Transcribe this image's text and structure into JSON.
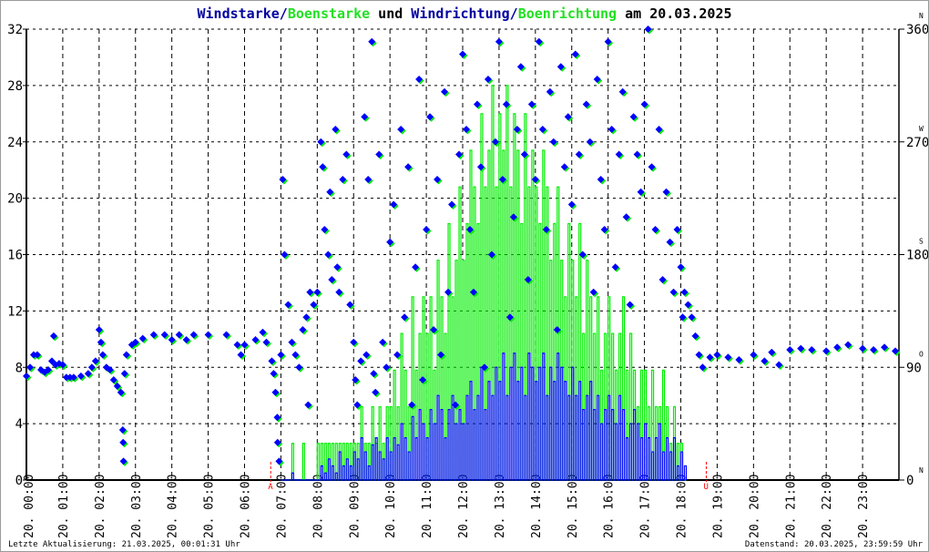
{
  "title": {
    "part1": "Windstarke",
    "sep1": "/",
    "part2": "Boenstarke",
    "mid": " und ",
    "part3": "Windrichtung",
    "sep2": "/",
    "part4": "Boenrichtung",
    "date_prefix": " am ",
    "date": "20.03.2025"
  },
  "footer": {
    "left": "Letzte Aktualisierung: 21.03.2025, 00:01:31 Uhr",
    "right": "Datenstand: 20.03.2025, 23:59:59 Uhr"
  },
  "colors": {
    "wind": "#0000ff",
    "gust": "#00ee00",
    "title_blue": "#0000a0",
    "marker": "#ff0000"
  },
  "chart_data": {
    "type": "line",
    "title": "Windstarke/Boenstarke und Windrichtung/Boenrichtung am 20.03.2025",
    "x_unit": "hour",
    "xlim": [
      0,
      24
    ],
    "x_tick_labels": [
      "20. 00:00",
      "20. 01:00",
      "20. 02:00",
      "20. 03:00",
      "20. 04:00",
      "20. 05:00",
      "20. 06:00",
      "20. 07:00",
      "20. 08:00",
      "20. 09:00",
      "20. 10:00",
      "20. 11:00",
      "20. 12:00",
      "20. 13:00",
      "20. 14:00",
      "20. 15:00",
      "20. 16:00",
      "20. 17:00",
      "20. 18:00",
      "20. 19:00",
      "20. 20:00",
      "20. 21:00",
      "20. 22:00",
      "20. 23:00"
    ],
    "ylim_left": [
      0,
      32
    ],
    "y_ticks_left": [
      "0",
      "4",
      "8",
      "12",
      "16",
      "20",
      "24",
      "28",
      "32"
    ],
    "ylim_right": [
      0,
      360
    ],
    "y_ticks_right": [
      "0",
      "90",
      "180",
      "270",
      "360"
    ],
    "compass_labels": [
      "N",
      "O",
      "S",
      "W",
      "N"
    ],
    "grid": true,
    "markers": [
      {
        "label": "A",
        "hour": 6.72
      },
      {
        "label": "U",
        "hour": 18.7
      }
    ],
    "speed": {
      "start_hour": 7.0,
      "step_hour": 0.1,
      "wind": [
        0,
        0,
        0,
        0.5,
        0,
        0,
        0,
        0,
        0,
        0,
        0,
        1,
        0.5,
        1.5,
        1,
        0.5,
        2,
        1,
        1.5,
        1,
        2,
        1.5,
        3,
        2,
        1,
        2.5,
        3,
        2,
        1.5,
        3,
        2,
        3,
        2.5,
        4,
        3,
        2,
        4.5,
        3,
        5,
        4,
        3,
        5,
        4,
        6,
        5,
        3,
        5,
        6,
        4,
        5,
        4,
        6,
        7,
        5,
        6,
        8,
        5,
        7,
        6,
        8,
        7,
        9,
        6,
        8,
        9,
        7,
        8,
        6,
        9,
        8,
        7,
        8,
        9,
        6,
        8,
        7,
        9,
        8,
        7,
        6,
        8,
        6,
        7,
        5,
        6,
        7,
        5,
        6,
        4,
        5,
        6,
        5,
        4,
        6,
        5,
        3,
        4,
        5,
        4,
        3,
        4,
        3,
        2,
        3,
        4,
        2,
        3,
        2,
        3,
        1,
        2,
        1
      ],
      "gust": [
        0,
        0,
        0,
        2.6,
        0,
        0,
        2.6,
        0,
        0,
        0,
        2.6,
        2.6,
        2.6,
        2.6,
        2.6,
        2.6,
        2.6,
        2.6,
        2.6,
        2.6,
        2.6,
        2.6,
        5.2,
        2.6,
        2.6,
        5.2,
        2.6,
        5.2,
        2.6,
        5.2,
        5.2,
        7.8,
        5.2,
        10.4,
        7.8,
        5.2,
        13,
        7.8,
        10.4,
        13,
        10.4,
        13,
        7.8,
        15.6,
        13,
        10.4,
        18.2,
        13,
        15.6,
        20.8,
        15.6,
        18.2,
        23.4,
        20.8,
        18.2,
        26,
        20.8,
        23.4,
        28,
        20.8,
        26,
        23.4,
        28,
        20.8,
        26,
        23.4,
        18.2,
        26,
        20.8,
        23.4,
        20.8,
        18.2,
        23.4,
        20.8,
        15.6,
        18.2,
        20.8,
        15.6,
        13,
        18.2,
        15.6,
        13,
        18.2,
        10.4,
        15.6,
        13,
        10.4,
        13,
        7.8,
        10.4,
        13,
        10.4,
        7.8,
        10.4,
        13,
        7.8,
        10.4,
        7.8,
        5.2,
        7.8,
        7.8,
        5.2,
        7.8,
        5.2,
        5.2,
        7.8,
        5.2,
        2.6,
        5.2,
        2.6,
        2.6,
        0
      ]
    },
    "direction": [
      [
        0.0,
        83
      ],
      [
        0.1,
        90
      ],
      [
        0.2,
        100
      ],
      [
        0.3,
        100
      ],
      [
        0.4,
        88
      ],
      [
        0.5,
        86
      ],
      [
        0.6,
        88
      ],
      [
        0.7,
        95
      ],
      [
        0.75,
        115
      ],
      [
        0.8,
        92
      ],
      [
        0.9,
        93
      ],
      [
        1.0,
        92
      ],
      [
        1.1,
        82
      ],
      [
        1.2,
        82
      ],
      [
        1.3,
        82
      ],
      [
        1.5,
        83
      ],
      [
        1.7,
        85
      ],
      [
        1.8,
        90
      ],
      [
        1.9,
        95
      ],
      [
        2.0,
        120
      ],
      [
        2.05,
        110
      ],
      [
        2.1,
        100
      ],
      [
        2.2,
        90
      ],
      [
        2.3,
        88
      ],
      [
        2.4,
        80
      ],
      [
        2.5,
        75
      ],
      [
        2.6,
        70
      ],
      [
        2.65,
        40
      ],
      [
        2.66,
        30
      ],
      [
        2.67,
        15
      ],
      [
        2.7,
        85
      ],
      [
        2.75,
        100
      ],
      [
        2.9,
        108
      ],
      [
        3.0,
        110
      ],
      [
        3.2,
        113
      ],
      [
        3.5,
        116
      ],
      [
        3.8,
        116
      ],
      [
        4.0,
        112
      ],
      [
        4.2,
        116
      ],
      [
        4.4,
        112
      ],
      [
        4.6,
        116
      ],
      [
        5.0,
        116
      ],
      [
        5.5,
        116
      ],
      [
        5.8,
        108
      ],
      [
        5.9,
        100
      ],
      [
        6.0,
        108
      ],
      [
        6.3,
        112
      ],
      [
        6.5,
        118
      ],
      [
        6.6,
        110
      ],
      [
        6.75,
        95
      ],
      [
        6.8,
        85
      ],
      [
        6.85,
        70
      ],
      [
        6.9,
        50
      ],
      [
        6.91,
        30
      ],
      [
        6.95,
        15
      ],
      [
        7.0,
        100
      ],
      [
        7.05,
        240
      ],
      [
        7.1,
        180
      ],
      [
        7.2,
        140
      ],
      [
        7.3,
        110
      ],
      [
        7.4,
        100
      ],
      [
        7.5,
        90
      ],
      [
        7.6,
        120
      ],
      [
        7.7,
        130
      ],
      [
        7.75,
        60
      ],
      [
        7.8,
        150
      ],
      [
        7.9,
        140
      ],
      [
        8.0,
        150
      ],
      [
        8.1,
        270
      ],
      [
        8.15,
        250
      ],
      [
        8.2,
        200
      ],
      [
        8.3,
        180
      ],
      [
        8.35,
        230
      ],
      [
        8.4,
        160
      ],
      [
        8.5,
        280
      ],
      [
        8.55,
        170
      ],
      [
        8.6,
        150
      ],
      [
        8.7,
        240
      ],
      [
        8.8,
        260
      ],
      [
        8.9,
        140
      ],
      [
        9.0,
        110
      ],
      [
        9.05,
        80
      ],
      [
        9.1,
        60
      ],
      [
        9.2,
        95
      ],
      [
        9.3,
        290
      ],
      [
        9.35,
        100
      ],
      [
        9.4,
        240
      ],
      [
        9.5,
        350
      ],
      [
        9.55,
        85
      ],
      [
        9.6,
        70
      ],
      [
        9.7,
        260
      ],
      [
        9.8,
        110
      ],
      [
        9.9,
        90
      ],
      [
        10.0,
        190
      ],
      [
        10.1,
        220
      ],
      [
        10.2,
        100
      ],
      [
        10.3,
        280
      ],
      [
        10.4,
        130
      ],
      [
        10.5,
        250
      ],
      [
        10.6,
        60
      ],
      [
        10.7,
        170
      ],
      [
        10.8,
        320
      ],
      [
        10.9,
        80
      ],
      [
        11.0,
        200
      ],
      [
        11.1,
        290
      ],
      [
        11.2,
        120
      ],
      [
        11.3,
        240
      ],
      [
        11.4,
        100
      ],
      [
        11.5,
        310
      ],
      [
        11.6,
        150
      ],
      [
        11.7,
        220
      ],
      [
        11.8,
        60
      ],
      [
        11.9,
        260
      ],
      [
        12.0,
        340
      ],
      [
        12.1,
        280
      ],
      [
        12.2,
        200
      ],
      [
        12.3,
        150
      ],
      [
        12.4,
        300
      ],
      [
        12.5,
        250
      ],
      [
        12.6,
        90
      ],
      [
        12.7,
        320
      ],
      [
        12.8,
        180
      ],
      [
        12.9,
        270
      ],
      [
        13.0,
        350
      ],
      [
        13.1,
        240
      ],
      [
        13.2,
        300
      ],
      [
        13.3,
        130
      ],
      [
        13.4,
        210
      ],
      [
        13.5,
        280
      ],
      [
        13.6,
        330
      ],
      [
        13.7,
        260
      ],
      [
        13.8,
        160
      ],
      [
        13.9,
        300
      ],
      [
        14.0,
        240
      ],
      [
        14.1,
        350
      ],
      [
        14.2,
        280
      ],
      [
        14.3,
        200
      ],
      [
        14.4,
        310
      ],
      [
        14.5,
        270
      ],
      [
        14.6,
        120
      ],
      [
        14.7,
        330
      ],
      [
        14.8,
        250
      ],
      [
        14.9,
        290
      ],
      [
        15.0,
        220
      ],
      [
        15.1,
        340
      ],
      [
        15.2,
        260
      ],
      [
        15.3,
        180
      ],
      [
        15.4,
        300
      ],
      [
        15.5,
        270
      ],
      [
        15.6,
        150
      ],
      [
        15.7,
        320
      ],
      [
        15.8,
        240
      ],
      [
        15.9,
        200
      ],
      [
        16.0,
        350
      ],
      [
        16.1,
        280
      ],
      [
        16.2,
        170
      ],
      [
        16.3,
        260
      ],
      [
        16.4,
        310
      ],
      [
        16.5,
        210
      ],
      [
        16.6,
        140
      ],
      [
        16.7,
        290
      ],
      [
        16.8,
        260
      ],
      [
        16.9,
        230
      ],
      [
        17.0,
        300
      ],
      [
        17.1,
        360
      ],
      [
        17.2,
        250
      ],
      [
        17.3,
        200
      ],
      [
        17.4,
        280
      ],
      [
        17.5,
        160
      ],
      [
        17.6,
        230
      ],
      [
        17.7,
        190
      ],
      [
        17.8,
        150
      ],
      [
        17.9,
        200
      ],
      [
        18.0,
        170
      ],
      [
        18.05,
        130
      ],
      [
        18.1,
        150
      ],
      [
        18.2,
        140
      ],
      [
        18.3,
        130
      ],
      [
        18.4,
        115
      ],
      [
        18.5,
        100
      ],
      [
        18.6,
        90
      ],
      [
        18.8,
        98
      ],
      [
        19.0,
        100
      ],
      [
        19.3,
        98
      ],
      [
        19.6,
        96
      ],
      [
        20.0,
        100
      ],
      [
        20.3,
        95
      ],
      [
        20.5,
        102
      ],
      [
        20.7,
        92
      ],
      [
        21.0,
        104
      ],
      [
        21.3,
        105
      ],
      [
        21.6,
        104
      ],
      [
        22.0,
        103
      ],
      [
        22.3,
        106
      ],
      [
        22.6,
        108
      ],
      [
        23.0,
        105
      ],
      [
        23.3,
        104
      ],
      [
        23.6,
        106
      ],
      [
        23.9,
        103
      ]
    ]
  }
}
